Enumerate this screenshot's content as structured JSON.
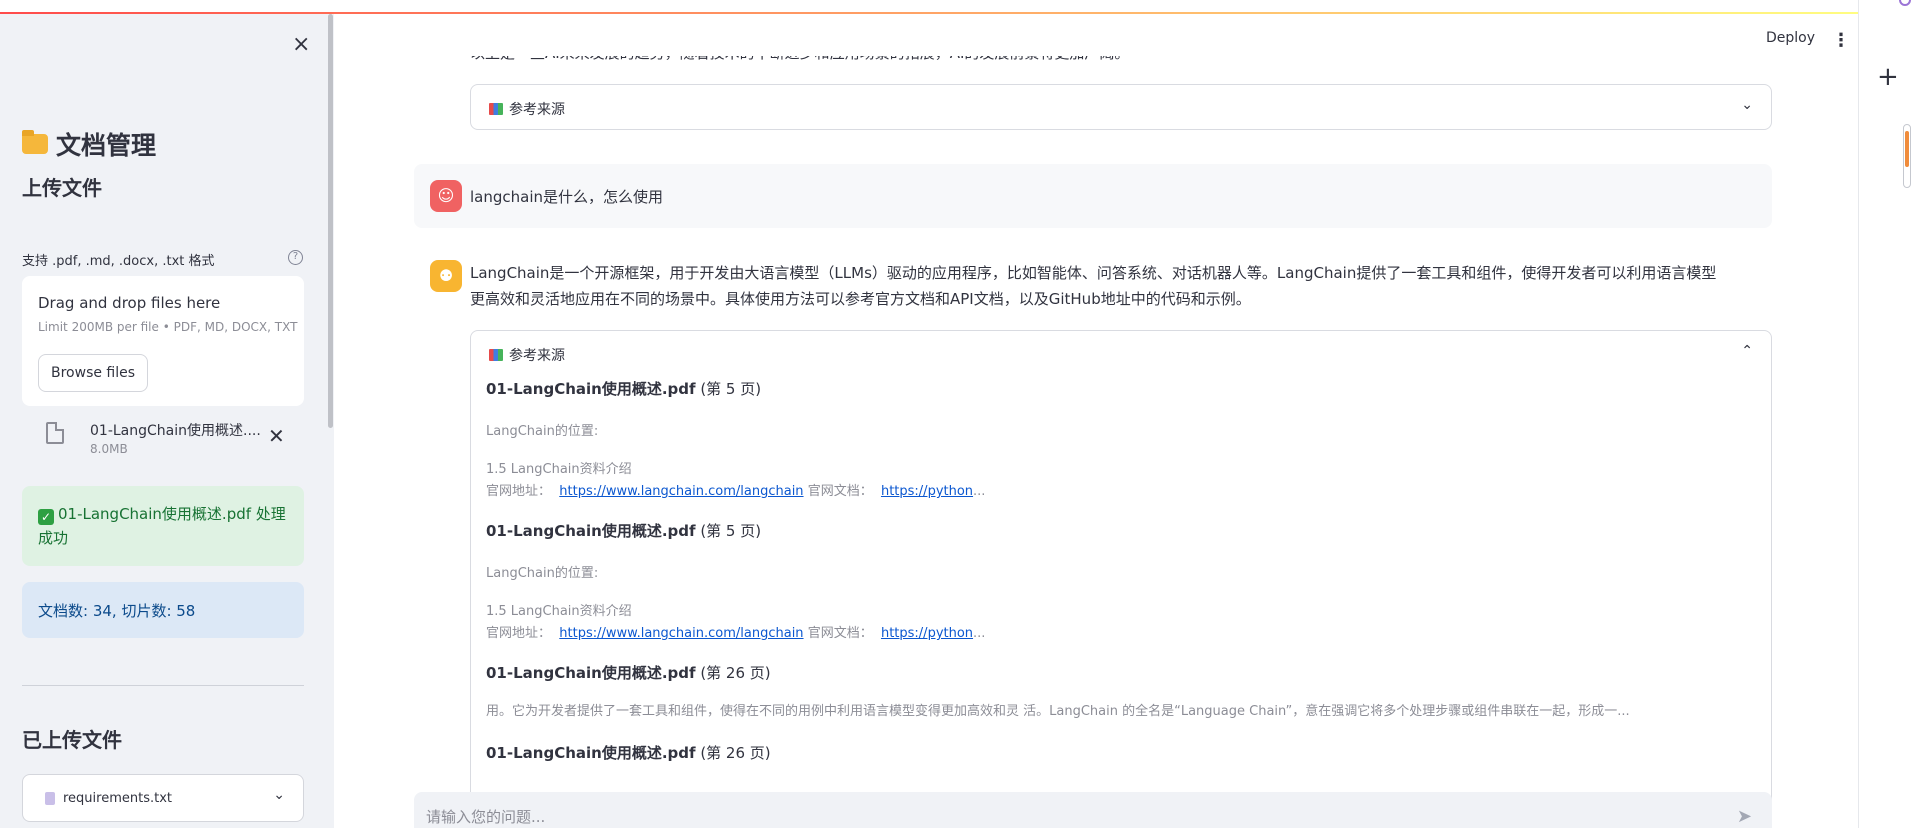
{
  "sidebar": {
    "close_icon": "×",
    "title": "文档管理",
    "upload_heading": "上传文件",
    "formats_label": "支持 .pdf, .md, .docx, .txt 格式",
    "dropzone": {
      "title": "Drag and drop files here",
      "limit": "Limit 200MB per file • PDF, MD, DOCX, TXT",
      "browse_label": "Browse files"
    },
    "uploaded_file": {
      "name": "01-LangChain使用概述....",
      "size": "8.0MB"
    },
    "success_message": "01-LangChain使用概述.pdf 处理成功",
    "info_message": "文档数: 34, 切片数: 58",
    "uploaded_heading": "已上传文件",
    "uploaded_select": "requirements.txt"
  },
  "header": {
    "deploy_label": "Deploy",
    "menu_icon": "⋮"
  },
  "chat": {
    "truncated_text": "以上是一些AI未来发展的趋势，随着技术的不断进步和应用场景的拓展，AI的发展前景将更加广阔。",
    "expander_label": "参考来源",
    "user_message": "langchain是什么，怎么使用",
    "assistant_message_line1": "LangChain是一个开源框架，用于开发由大语言模型（LLMs）驱动的应用程序，比如智能体、问答系统、对话机器人等。LangChain提供了一套工具和组件，使得开发者可以利用语言模型",
    "assistant_message_line2": "更高效和灵活地应用在不同的场景中。具体使用方法可以参考官方文档和API文档，以及GitHub地址中的代码和示例。",
    "sources": [
      {
        "file": "01-LangChain使用概述.pdf",
        "page": "(第 5 页)",
        "line1": "LangChain的位置:",
        "line2": "1.5 LangChain资料介绍",
        "line3_prefix": "官网地址：",
        "link1": "https://www.langchain.com/langchain",
        "line3_mid": "官网文档：",
        "link2": "https://python",
        "ellipsis": "..."
      },
      {
        "file": "01-LangChain使用概述.pdf",
        "page": "(第 5 页)",
        "line1": "LangChain的位置:",
        "line2": "1.5 LangChain资料介绍",
        "line3_prefix": "官网地址：",
        "link1": "https://www.langchain.com/langchain",
        "line3_mid": "官网文档：",
        "link2": "https://python",
        "ellipsis": "..."
      },
      {
        "file": "01-LangChain使用概述.pdf",
        "page": "(第 26 页)",
        "line1": "用。它为开发者提供了一套工具和组件，使得在不同的用例中利用语言模型变得更加高效和灵 活。LangChain 的全名是“Language Chain”，意在强调它将多个处理步骤或组件串联在一起，形成一..."
      },
      {
        "file": "01-LangChain使用概述.pdf",
        "page": "(第 26 页)"
      }
    ],
    "input_placeholder": "请输入您的问题...",
    "send_icon": "➤"
  },
  "colors": {
    "accent": "#ff4b4b",
    "user_avatar": "#f06262",
    "assistant_avatar": "#f8b531",
    "success_bg": "#dff2e3",
    "info_bg": "#dce8f6"
  }
}
